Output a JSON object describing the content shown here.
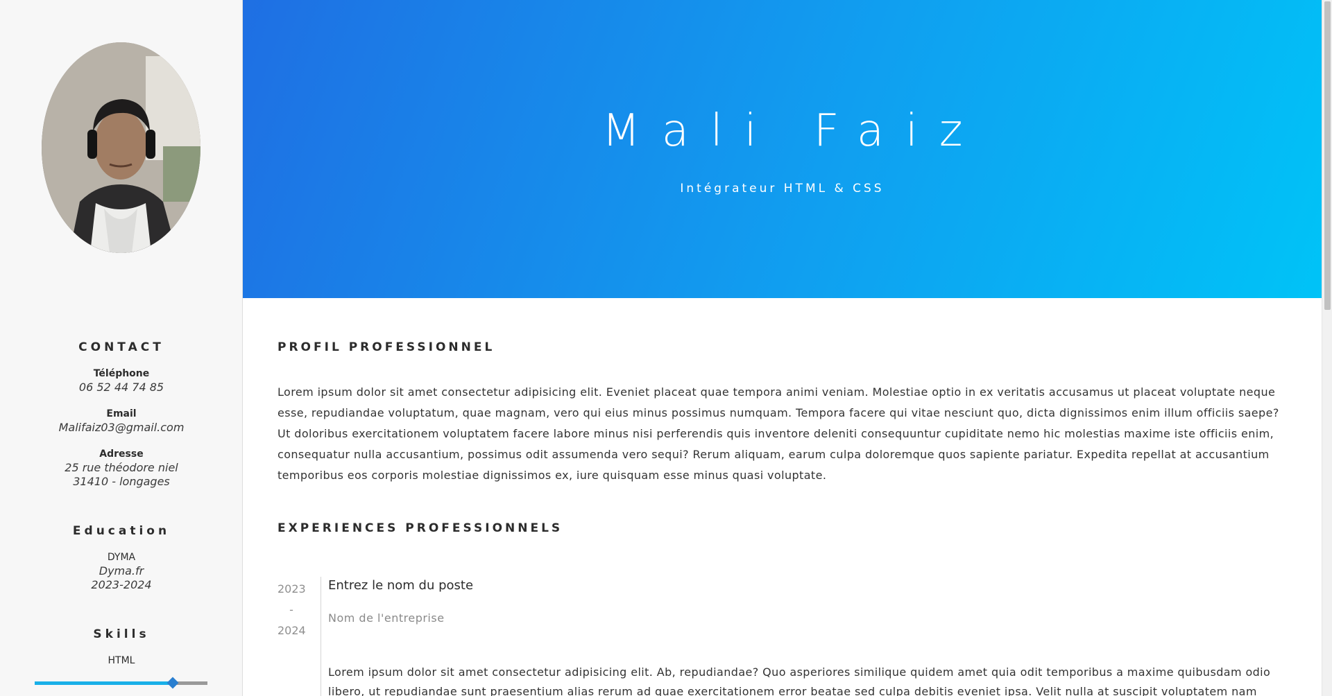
{
  "header": {
    "name": "Mali Faiz",
    "title": "Intégrateur HTML & CSS"
  },
  "sidebar": {
    "contact": {
      "heading": "CONTACT",
      "phone_label": "Téléphone",
      "phone_value": "06 52 44 74 85",
      "email_label": "Email",
      "email_value": "Malifaiz03@gmail.com",
      "address_label": "Adresse",
      "address_line1": "25 rue théodore niel",
      "address_line2": "31410 - longages"
    },
    "education": {
      "heading": "Education",
      "school": "DYMA",
      "site": "Dyma.fr",
      "years": "2023-2024"
    },
    "skills": {
      "heading": "Skills",
      "items": [
        {
          "name": "HTML",
          "level_percent": 80
        }
      ]
    }
  },
  "main": {
    "profile": {
      "heading": "PROFIL PROFESSIONNEL",
      "text": "Lorem ipsum dolor sit amet consectetur adipisicing elit. Eveniet placeat quae tempora animi veniam. Molestiae optio in ex veritatis accusamus ut placeat voluptate neque esse, repudiandae voluptatum, quae magnam, vero qui eius minus possimus numquam. Tempora facere qui vitae nesciunt quo, dicta dignissimos enim illum officiis saepe? Ut doloribus exercitationem voluptatem facere labore minus nisi perferendis quis inventore deleniti consequuntur cupiditate nemo hic molestias maxime iste officiis enim, consequatur nulla accusantium, possimus odit assumenda vero sequi? Rerum aliquam, earum culpa doloremque quos sapiente pariatur. Expedita repellat at accusantium temporibus eos corporis molestiae dignissimos ex, iure quisquam esse minus quasi voluptate."
    },
    "experiences": {
      "heading": "EXPERIENCES PROFESSIONNELS",
      "items": [
        {
          "year_start": "2023",
          "separator": "-",
          "year_end": "2024",
          "position": "Entrez le nom du poste",
          "company": "Nom de l'entreprise",
          "description": "Lorem ipsum dolor sit amet consectetur adipisicing elit. Ab, repudiandae? Quo asperiores similique quidem amet quia odit temporibus a maxime quibusdam odio libero, ut repudiandae sunt praesentium alias rerum ad quae exercitationem error beatae sed culpa debitis eveniet ipsa. Velit nulla at suscipit voluptatem nam obcaecati fugit."
        }
      ]
    }
  },
  "colors": {
    "header_gradient_start": "#1f6fe3",
    "header_gradient_end": "#00c3f7",
    "skill_bar": "#19b0e8",
    "sidebar_bg": "#f7f7f7"
  }
}
